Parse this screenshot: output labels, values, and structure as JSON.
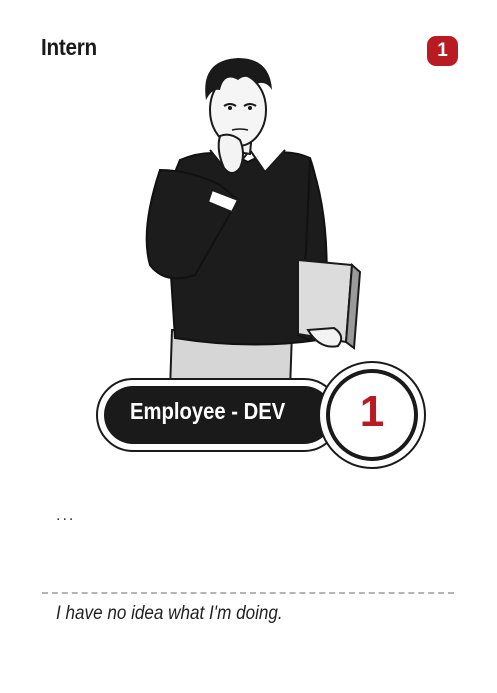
{
  "card": {
    "title": "Intern",
    "cost": "1",
    "role": "Employee - DEV",
    "level": "1",
    "ability_text": "...",
    "flavor_text": "I have no idea what I'm doing.",
    "accent_color": "#b81c22",
    "illustration": "thinking-intern-illustration"
  }
}
